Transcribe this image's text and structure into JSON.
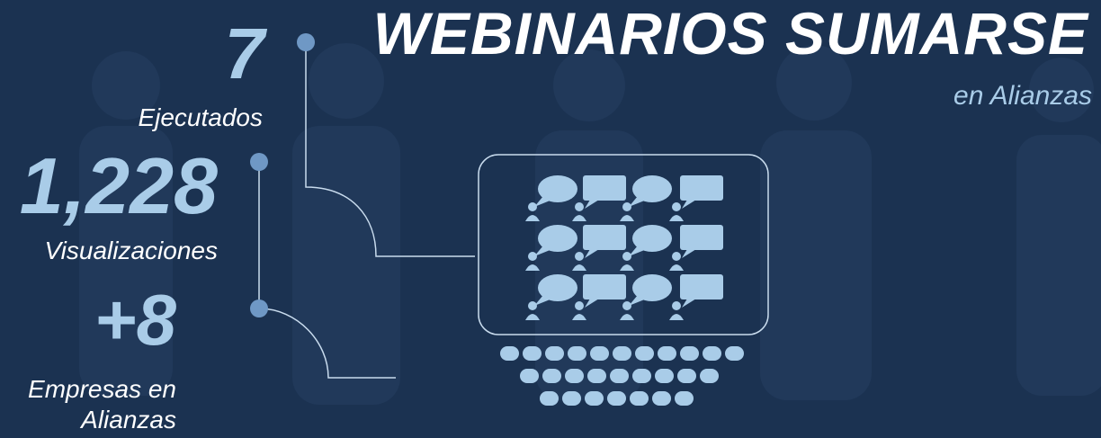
{
  "header": {
    "title": "WEBINARIOS SUMARSE",
    "subtitle": "en Alianzas"
  },
  "stats": [
    {
      "value": "7",
      "label": "Ejecutados"
    },
    {
      "value": "1,228",
      "label": "Visualizaciones"
    },
    {
      "value": "+8",
      "label": "Empresas en Alianzas"
    }
  ],
  "colors": {
    "background": "#1b3251",
    "accent": "#a9cce8",
    "dot": "#6f98c5",
    "text": "#ffffff"
  },
  "icons": [
    "person-silhouette-icon",
    "speech-bubble-icon",
    "chat-square-icon",
    "user-icon",
    "keyboard-key-icon"
  ]
}
